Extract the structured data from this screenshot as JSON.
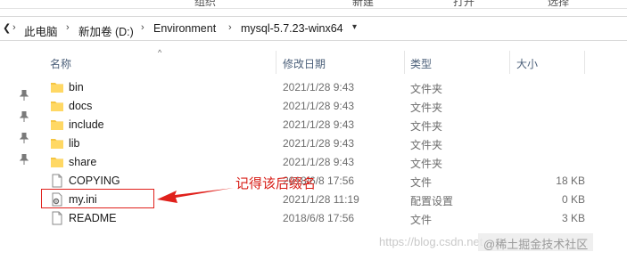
{
  "ribbon": {
    "items": [
      "组织",
      "新建",
      "打开",
      "选择"
    ]
  },
  "address_bar": {
    "breadcrumbs": [
      "此电脑",
      "新加卷 (D:)",
      "Environment",
      "mysql-5.7.23-winx64"
    ]
  },
  "columns": {
    "name": "名称",
    "date": "修改日期",
    "type": "类型",
    "size": "大小"
  },
  "files": [
    {
      "name": "bin",
      "date": "2021/1/28 9:43",
      "type": "文件夹",
      "size": "",
      "icon": "folder-icon"
    },
    {
      "name": "docs",
      "date": "2021/1/28 9:43",
      "type": "文件夹",
      "size": "",
      "icon": "folder-icon"
    },
    {
      "name": "include",
      "date": "2021/1/28 9:43",
      "type": "文件夹",
      "size": "",
      "icon": "folder-icon"
    },
    {
      "name": "lib",
      "date": "2021/1/28 9:43",
      "type": "文件夹",
      "size": "",
      "icon": "folder-icon"
    },
    {
      "name": "share",
      "date": "2021/1/28 9:43",
      "type": "文件夹",
      "size": "",
      "icon": "folder-icon"
    },
    {
      "name": "COPYING",
      "date": "2018/6/8 17:56",
      "type": "文件",
      "size": "18 KB",
      "icon": "file-icon"
    },
    {
      "name": "my.ini",
      "date": "2021/1/28 11:19",
      "type": "配置设置",
      "size": "0 KB",
      "icon": "settings-file-icon"
    },
    {
      "name": "README",
      "date": "2018/6/8 17:56",
      "type": "文件",
      "size": "3 KB",
      "icon": "file-icon"
    }
  ],
  "annotation": {
    "text": "记得该后缀名",
    "color": "#d81e17"
  },
  "watermark": {
    "left": "https://blog.csdn.net",
    "right": "@稀土掘金技术社区"
  },
  "colors": {
    "folder": "#f5c542",
    "header_text": "#4c607a",
    "highlight": "#e0201b"
  }
}
